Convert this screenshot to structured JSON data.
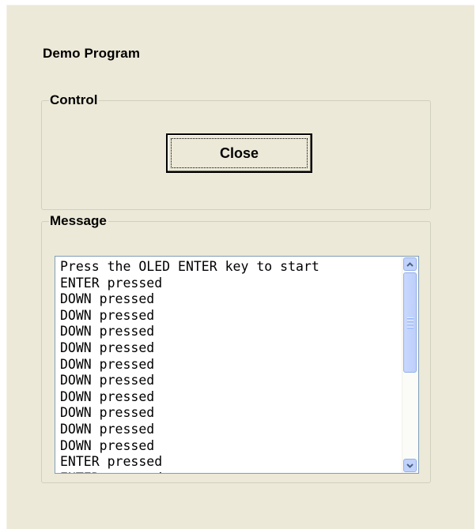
{
  "window": {
    "title": "Demo Program"
  },
  "control": {
    "legend": "Control",
    "close_label": "Close"
  },
  "message": {
    "legend": "Message",
    "lines": [
      "Press the OLED ENTER key to start",
      "ENTER pressed",
      "DOWN pressed",
      "DOWN pressed",
      "DOWN pressed",
      "DOWN pressed",
      "DOWN pressed",
      "DOWN pressed",
      "DOWN pressed",
      "DOWN pressed",
      "DOWN pressed",
      "DOWN pressed",
      "ENTER pressed",
      "ENTER pressed"
    ]
  },
  "scrollbar": {
    "up_icon": "chevron-up-icon",
    "down_icon": "chevron-down-icon",
    "colors": {
      "button": "#c1d3fb",
      "arrow": "#4d6185"
    }
  }
}
